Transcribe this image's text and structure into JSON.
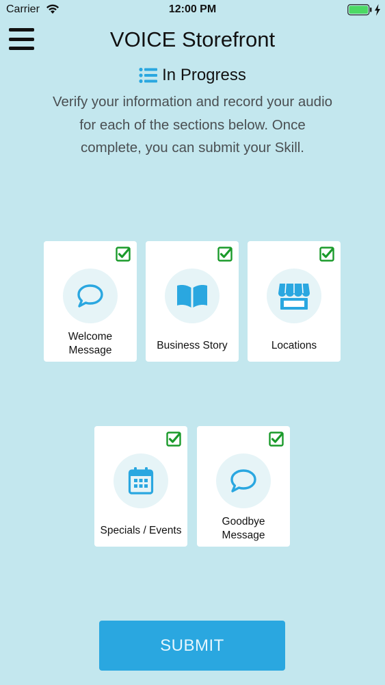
{
  "status_bar": {
    "carrier": "Carrier",
    "time": "12:00 PM"
  },
  "header": {
    "title": "VOICE Storefront"
  },
  "progress": {
    "label": "In Progress"
  },
  "instructions": "Verify your information and record your audio for each of the sections below. Once complete, you can submit your Skill.",
  "sections": [
    {
      "label": "Welcome Message",
      "icon": "chat-bubble-icon",
      "completed": true
    },
    {
      "label": "Business Story",
      "icon": "book-icon",
      "completed": true
    },
    {
      "label": "Locations",
      "icon": "storefront-icon",
      "completed": true
    },
    {
      "label": "Specials / Events",
      "icon": "calendar-icon",
      "completed": true
    },
    {
      "label": "Goodbye Message",
      "icon": "chat-bubble-icon",
      "completed": true
    }
  ],
  "submit_label": "SUBMIT",
  "colors": {
    "background": "#c3e7ee",
    "accent": "#2aa7e0",
    "check": "#1a9a2a",
    "icon_circle": "#e6f4f7"
  }
}
